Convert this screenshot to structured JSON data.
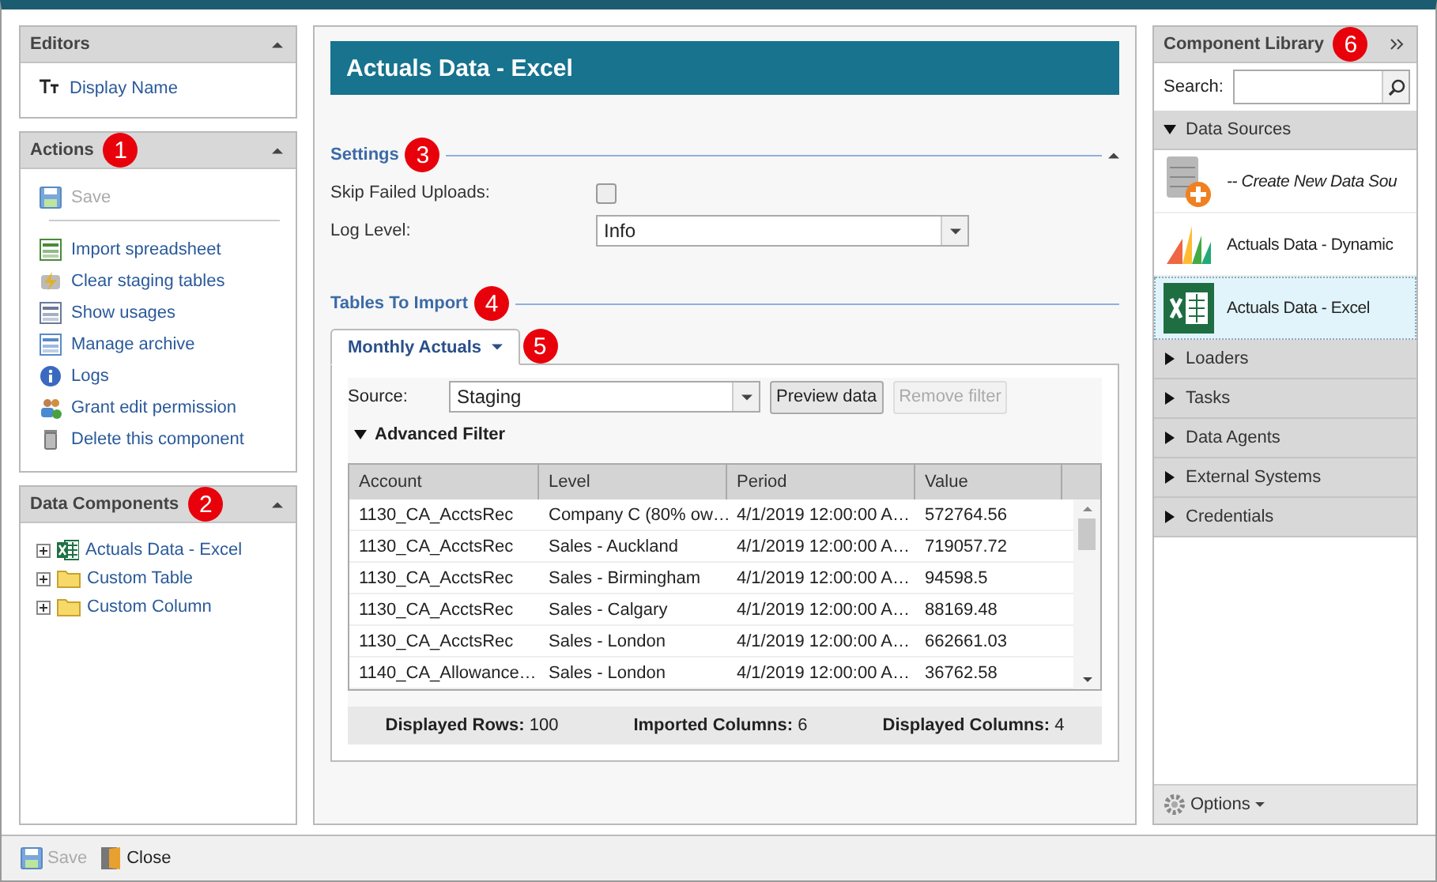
{
  "editors": {
    "title": "Editors",
    "expanded": true,
    "items": [
      {
        "label": "Display Name"
      }
    ]
  },
  "actions": {
    "title": "Actions",
    "badge": "1",
    "expanded": true,
    "save": {
      "label": "Save",
      "disabled": true
    },
    "items": [
      {
        "label": "Import spreadsheet",
        "kind": "import"
      },
      {
        "label": "Clear staging tables",
        "kind": "clear"
      },
      {
        "label": "Show usages",
        "kind": "usages"
      },
      {
        "label": "Manage archive",
        "kind": "archive"
      },
      {
        "label": "Logs",
        "kind": "info"
      },
      {
        "label": "Grant edit permission",
        "kind": "people"
      },
      {
        "label": "Delete this component",
        "kind": "trash"
      }
    ]
  },
  "data_components": {
    "title": "Data Components",
    "badge": "2",
    "expanded": true,
    "tree": [
      {
        "label": "Actuals Data - Excel",
        "kind": "excel",
        "expanded": false
      },
      {
        "label": "Custom Table",
        "kind": "folder",
        "expanded": false
      },
      {
        "label": "Custom Column",
        "kind": "folder",
        "expanded": false
      }
    ]
  },
  "editor": {
    "title": "Actuals Data - Excel",
    "settings": {
      "title": "Settings",
      "badge": "3",
      "expanded": true,
      "skip_failed_uploads": {
        "label": "Skip Failed Uploads:",
        "checked": false
      },
      "log_level": {
        "label": "Log Level:",
        "value": "Info"
      }
    },
    "tables": {
      "title": "Tables To Import",
      "badge": "4",
      "tabs": [
        {
          "label": "Monthly Actuals",
          "selected": true,
          "badge": "5"
        }
      ],
      "source": {
        "label": "Source:",
        "value": "Staging"
      },
      "buttons": [
        {
          "label": "Preview data",
          "disabled": false
        },
        {
          "label": "Remove filter",
          "disabled": true
        }
      ],
      "advanced_filter": {
        "label": "Advanced Filter",
        "expanded": true
      },
      "table": {
        "columns": [
          "Account",
          "Level",
          "Period",
          "Value"
        ],
        "rows": [
          [
            "1130_CA_AcctsRec",
            "Company C (80% ow…",
            "4/1/2019 12:00:00 A…",
            "572764.56"
          ],
          [
            "1130_CA_AcctsRec",
            "Sales - Auckland",
            "4/1/2019 12:00:00 A…",
            "719057.72"
          ],
          [
            "1130_CA_AcctsRec",
            "Sales - Birmingham",
            "4/1/2019 12:00:00 A…",
            "94598.5"
          ],
          [
            "1130_CA_AcctsRec",
            "Sales - Calgary",
            "4/1/2019 12:00:00 A…",
            "88169.48"
          ],
          [
            "1130_CA_AcctsRec",
            "Sales - London",
            "4/1/2019 12:00:00 A…",
            "662661.03"
          ],
          [
            "1140_CA_Allowance…",
            "Sales - London",
            "4/1/2019 12:00:00 A…",
            "36762.58"
          ]
        ]
      },
      "summary": [
        {
          "label": "Displayed Rows:",
          "value": "100"
        },
        {
          "label": "Imported Columns:",
          "value": "6"
        },
        {
          "label": "Displayed Columns:",
          "value": "4"
        }
      ]
    }
  },
  "library": {
    "title": "Component Library",
    "badge": "6",
    "search": {
      "label": "Search:"
    },
    "sections": [
      {
        "label": "Data Sources",
        "expanded": true,
        "items": [
          {
            "label": "-- Create New Data Sou",
            "kind": "create",
            "selected": false
          },
          {
            "label": "Actuals Data - Dynamic",
            "kind": "dynamics",
            "selected": false
          },
          {
            "label": "Actuals Data - Excel",
            "kind": "excel",
            "selected": true
          }
        ]
      },
      {
        "label": "Loaders",
        "expanded": false
      },
      {
        "label": "Tasks",
        "expanded": false
      },
      {
        "label": "Data Agents",
        "expanded": false
      },
      {
        "label": "External Systems",
        "expanded": false
      },
      {
        "label": "Credentials",
        "expanded": false
      }
    ],
    "options": "Options"
  },
  "footer": {
    "save": {
      "label": "Save",
      "disabled": true
    },
    "close": {
      "label": "Close"
    }
  }
}
